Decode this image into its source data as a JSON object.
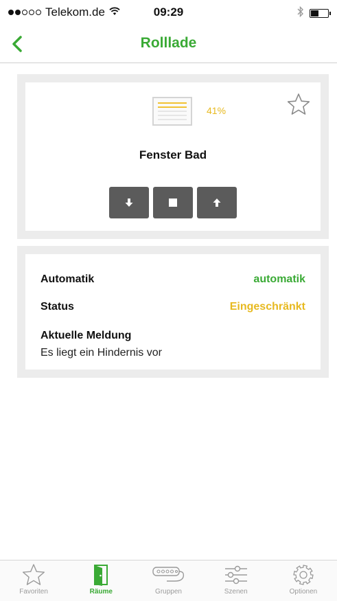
{
  "status_bar": {
    "carrier": "Telekom.de",
    "time": "09:29",
    "signal_bars_filled": 2,
    "signal_bars_total": 5,
    "battery_level": 0.45
  },
  "nav": {
    "title": "Rolllade",
    "back_icon": "chevron-left-icon"
  },
  "device": {
    "name": "Fenster Bad",
    "position_label": "41%",
    "position_value": 41,
    "favorite_icon": "star-outline-icon",
    "controls": [
      {
        "name": "down",
        "icon": "arrow-down-icon"
      },
      {
        "name": "stop",
        "icon": "stop-square-icon"
      },
      {
        "name": "up",
        "icon": "arrow-up-icon"
      }
    ]
  },
  "info": {
    "automatik_label": "Automatik",
    "automatik_value": "automatik",
    "status_label": "Status",
    "status_value": "Eingeschränkt",
    "message_label": "Aktuelle Meldung",
    "message_text": "Es liegt ein Hindernis vor"
  },
  "tabs": [
    {
      "label": "Favoriten",
      "icon": "star-icon",
      "active": false
    },
    {
      "label": "Räume",
      "icon": "door-icon",
      "active": true
    },
    {
      "label": "Gruppen",
      "icon": "power-strip-icon",
      "active": false
    },
    {
      "label": "Szenen",
      "icon": "sliders-icon",
      "active": false
    },
    {
      "label": "Optionen",
      "icon": "gear-icon",
      "active": false
    }
  ],
  "colors": {
    "accent_green": "#3aaa35",
    "status_yellow": "#e7b91f",
    "button_gray": "#5b5b5b",
    "card_background": "#ececec"
  }
}
